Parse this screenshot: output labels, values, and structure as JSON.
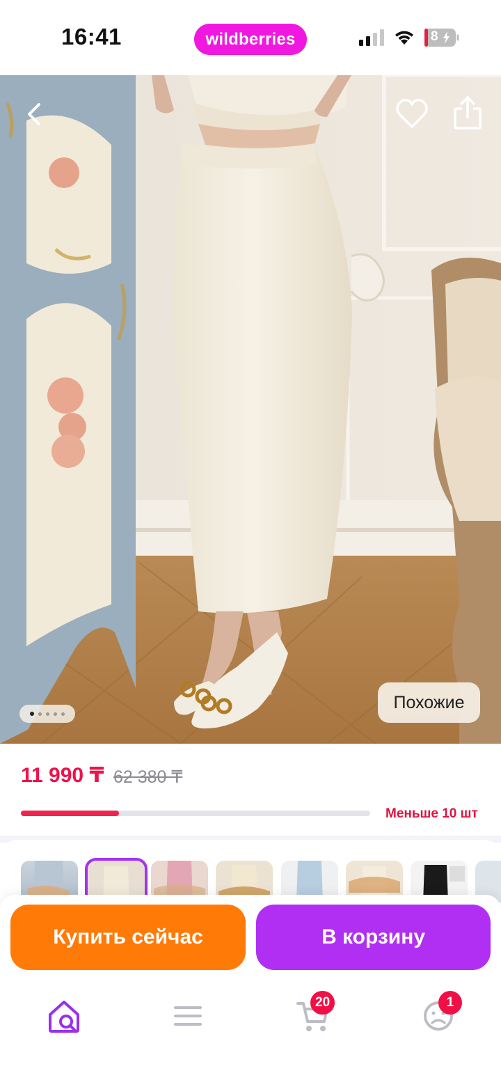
{
  "status_bar": {
    "time": "16:41",
    "brand": "wildberries",
    "battery": "8"
  },
  "photo": {
    "slide_count": 5,
    "active_slide": 1,
    "similar_label": "Похожие"
  },
  "price": {
    "current": "11 990 ₸",
    "old": "62 380 ₸",
    "stock_label": "Меньше 10 шт",
    "stock_fraction": 0.28
  },
  "actions": {
    "buy_now": "Купить сейчас",
    "add_to_cart": "В корзину"
  },
  "tab_bar": {
    "cart_badge": "20",
    "profile_badge": "1"
  },
  "colors": {
    "brand": "#f018e0",
    "price": "#f0124b",
    "buy_now": "#ff7a06",
    "cart": "#b02ff3",
    "accent": "#a532f0"
  }
}
